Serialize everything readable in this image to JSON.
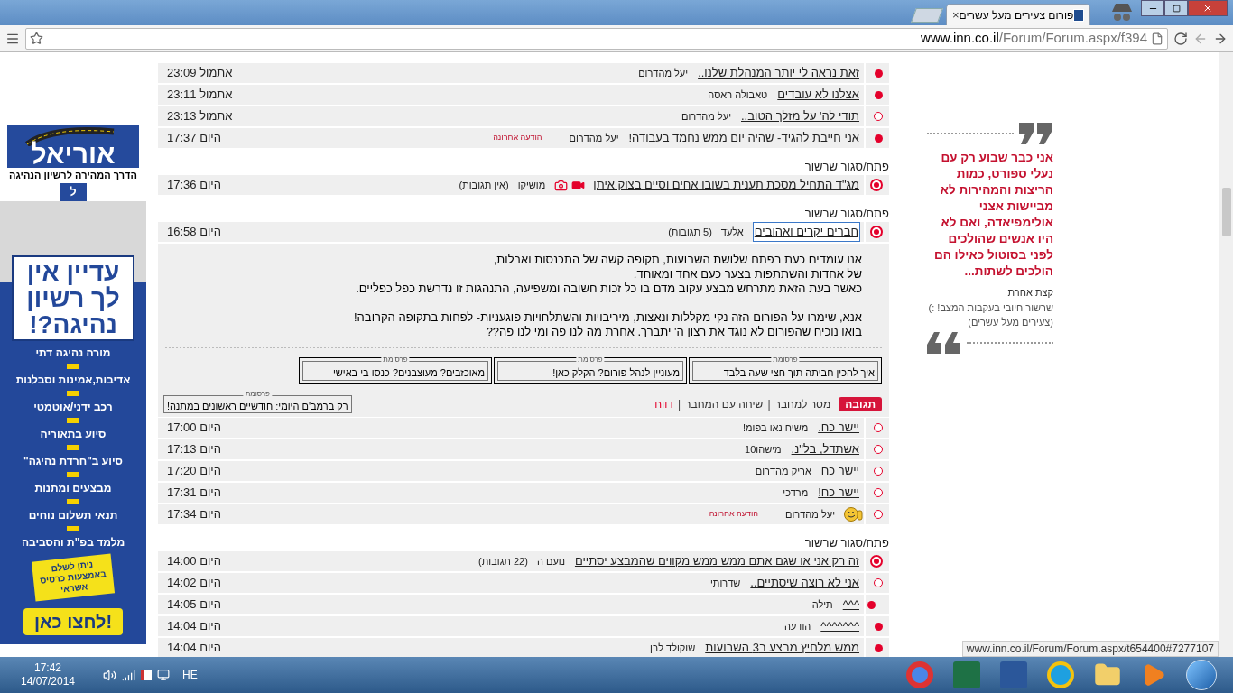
{
  "browser": {
    "tab_title": "פורום צעירים מעל עשרים",
    "tab_close": "×",
    "url_host": "www.inn.co.il",
    "url_path": "/Forum/Forum.aspx/f394",
    "status_url": "www.inn.co.il/Forum/Forum.aspx/t654400#7277107"
  },
  "ad_banner": {
    "brand": "אוריאל",
    "tagline": "הדרך המהירה לרשיון הנהיגה",
    "plate": "ל",
    "headline": "עדיין אין לך רשיון נהיגה?!",
    "features": [
      "מורה נהיגה דתי",
      "אדיבות,אמינות וסבלנות",
      "רכב ידני/אוטמטי",
      "סיוע בתאוריה",
      "סיוע ב\"חרדת נהיגה\"",
      "מבצעים ומתנות",
      "תנאי תשלום נוחים",
      "מלמד בפ\"ת והסביבה"
    ],
    "payment_note": "ניתן לשלם באמצעות כרטיס אשראי",
    "cta": "לחצו כאן!"
  },
  "threads": [
    {
      "rows": [
        {
          "kind": "reply",
          "unread": true,
          "title": "זאת נראה לי יותר המנהלת שלנו..",
          "author": "יעל מהדרום",
          "time": "אתמול 23:09"
        },
        {
          "kind": "reply",
          "unread": true,
          "title": "אצלנו לא עובדים",
          "author": "טאבולה ראסה",
          "time": "אתמול 23:11"
        },
        {
          "kind": "reply",
          "unread": false,
          "title": "תודי לה' על מזלך הטוב..",
          "author": "יעל מהדרום",
          "time": "אתמול 23:13"
        },
        {
          "kind": "reply",
          "unread": true,
          "title": "אני חייבת להגיד- שהיה יום ממש נחמד בעבודה!",
          "author": "יעל מהדרום",
          "note": {
            "kind": "last",
            "text": "הודעה אחרונה"
          },
          "time": "היום 17:37"
        }
      ]
    },
    {
      "toggle_label": "פתח/סגור שרשור",
      "rows": [
        {
          "kind": "root",
          "unread": true,
          "title": "מג\"ד התחיל מסכת תענית בשובו אחים וסיים בצוק איתן",
          "icons": [
            {
              "kind": "video"
            },
            {
              "kind": "camera"
            }
          ],
          "author": "מושיקו",
          "note": {
            "kind": "count",
            "text": "(אין תגובות)"
          },
          "time": "היום 17:36"
        }
      ]
    },
    {
      "toggle_label": "פתח/סגור שרשור",
      "rows": [
        {
          "kind": "root",
          "unread": true,
          "selected": true,
          "title": "חברים יקרים ואהובים",
          "author": "אלעד",
          "note": {
            "kind": "count",
            "text": "(5 תגובות)"
          },
          "time": "היום 16:58",
          "post": {
            "paragraphs": [
              [
                "אנו עומדים כעת בפתח שלושת השבועות, תקופה קשה של התכנסות ואבלות,",
                "של אחדות והשתתפות בצער כעם אחד ומאוחד.",
                "כאשר בעת הזאת מתרחש מבצע עקוב מדם בו כל זכות חשובה ומשפיעה, התנהגות זו נדרשת כפל כפליים."
              ],
              [
                "אנא, שימרו על הפורום הזה נקי מקללות ונאצות, מיריבויות והשתלחויות פוגעניות- לפחות בתקופה הקרובה!",
                "בואו נוכיח שהפורום לא נוגד את רצון ה' יתברך. אחרת מה לנו פה ומי לנו פה??"
              ]
            ],
            "ads": [
              {
                "label": "פרסומת",
                "text": "איך להכין חביתה תוך חצי שעה בלבד"
              },
              {
                "label": "פרסומת",
                "text": "מעוניין לנהל פורום? הקלק כאן!"
              },
              {
                "label": "פרסומת",
                "text": "מאוכזבים? מעוצבנים? כנסו בי באישי"
              }
            ],
            "wide_ad": {
              "label": "פרסומת",
              "text": "רק ברמב'ם היומי: חודשיים ראשונים במתנה!"
            },
            "actions": [
              {
                "kind": "button",
                "text": "תגובה"
              },
              {
                "kind": "link",
                "text": "מסר למחבר"
              },
              {
                "kind": "separator",
                "text": "|"
              },
              {
                "kind": "link",
                "text": "שיחה עם המחבר"
              },
              {
                "kind": "separator",
                "text": "|"
              },
              {
                "kind": "alert",
                "text": "דווח"
              }
            ]
          }
        },
        {
          "kind": "reply",
          "unread": false,
          "title": "יישר כח.",
          "author": "משיח נאו בפומ!",
          "time": "היום 17:00"
        },
        {
          "kind": "reply",
          "unread": false,
          "title": "אשתדל, בל\"נ.",
          "author": "מישהו10",
          "time": "היום 17:13"
        },
        {
          "kind": "reply",
          "unread": false,
          "title": "יישר כח",
          "author": "אריק מהדרום",
          "time": "היום 17:20"
        },
        {
          "kind": "reply",
          "unread": false,
          "title": "יישר כח!",
          "author": "מרדכי",
          "time": "היום 17:31"
        },
        {
          "kind": "reply",
          "unread": false,
          "icons": [
            {
              "kind": "smiley"
            }
          ],
          "author": "יעל מהדרום",
          "note": {
            "kind": "last",
            "text": "הודעה אחרונה"
          },
          "time": "היום 17:34"
        }
      ]
    },
    {
      "toggle_label": "פתח/סגור שרשור",
      "rows": [
        {
          "kind": "root",
          "unread": true,
          "title": "זה רק אני או שגם אתם ממש ממש מקווים שהמבצע יסתיים",
          "author": "נועם ה",
          "note": {
            "kind": "count",
            "text": "(22 תגובות)"
          },
          "time": "היום 14:00"
        },
        {
          "kind": "reply",
          "unread": false,
          "title": "אני לא רוצה שיסתיים..",
          "author": "שדרותי",
          "time": "היום 14:02",
          "children": [
            {
              "kind": "reply",
              "unread": true,
              "title": "^^^",
              "author": "תילה",
              "time": "היום 14:05"
            }
          ]
        },
        {
          "kind": "reply",
          "unread": true,
          "title": "^^^^^^^",
          "author": "הודעה",
          "time": "היום 14:04"
        },
        {
          "kind": "reply",
          "unread": true,
          "title": "ממש מלחיץ מבצע ב3 השבועות",
          "author": "שוקולד לבן",
          "time": "היום 14:04"
        }
      ]
    }
  ],
  "quote": {
    "text": "אני כבר שבוע רק עם נעלי ספורט, כמות הריצות והמהירות לא מביישות אצני אולימפיאדה, ואם לא היו אנשים שהולכים לפני בסוטול כאילו הם הולכים לשתות...",
    "author": "קצת אחרת",
    "thread": "שרשור חיובי בעקבות המצב! :)",
    "forum": "(צעירים מעל עשרים)"
  },
  "taskbar": {
    "time": "17:42",
    "date": "14/07/2014",
    "language": "HE"
  }
}
